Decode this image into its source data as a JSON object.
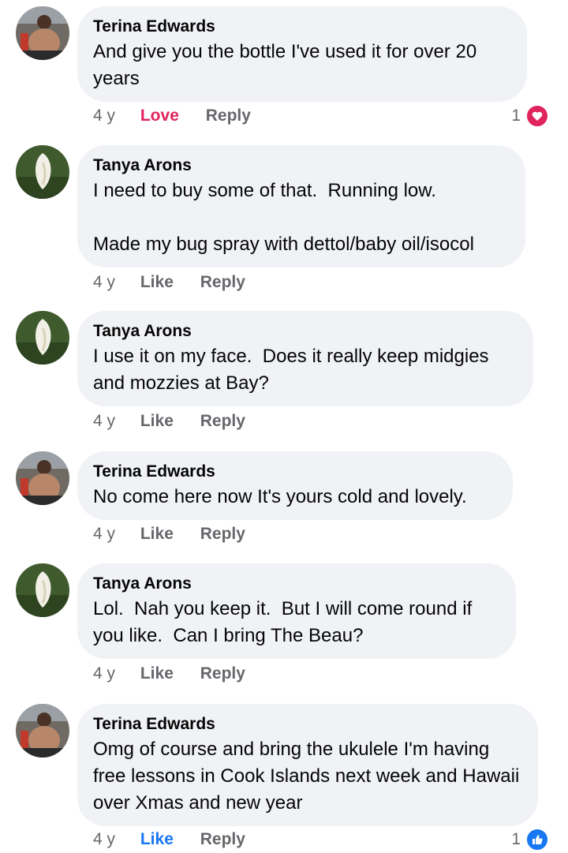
{
  "comments": [
    {
      "author": "Terina Edwards",
      "text": "And give you the bottle I've used it for over 20 years",
      "time": "4 y",
      "reaction_label": "Love",
      "reply_label": "Reply",
      "reaction_count": "1",
      "reaction_icon": "heart-icon",
      "avatar": "terina-avatar"
    },
    {
      "author": "Tanya Arons",
      "text": "I need to buy some of that.  Running low.\n\nMade my bug spray with dettol/baby oil/isocol",
      "time": "4 y",
      "reaction_label": "Like",
      "reply_label": "Reply",
      "avatar": "tanya-avatar"
    },
    {
      "author": "Tanya Arons",
      "text": "I use it on my face.  Does it really keep midgies and mozzies at Bay?",
      "time": "4 y",
      "reaction_label": "Like",
      "reply_label": "Reply",
      "avatar": "tanya-avatar"
    },
    {
      "author": "Terina Edwards",
      "text": "No come here now It's yours cold and lovely.",
      "time": "4 y",
      "reaction_label": "Like",
      "reply_label": "Reply",
      "avatar": "terina-avatar"
    },
    {
      "author": "Tanya Arons",
      "text": "Lol.  Nah you keep it.  But I will come round if you like.  Can I bring The Beau?",
      "time": "4 y",
      "reaction_label": "Like",
      "reply_label": "Reply",
      "avatar": "tanya-avatar"
    },
    {
      "author": "Terina Edwards",
      "text": "Omg of course and bring the ukulele I'm having free lessons in Cook Islands next week and Hawaii over Xmas and new year",
      "time": "4 y",
      "reaction_label": "Like",
      "reply_label": "Reply",
      "reaction_count": "1",
      "reaction_icon": "thumbs-up-icon",
      "avatar": "terina-avatar"
    }
  ],
  "colors": {
    "love": "#e0245e",
    "like_active": "#1877f2",
    "bubble": "#f0f2f5",
    "meta": "#65676b"
  }
}
